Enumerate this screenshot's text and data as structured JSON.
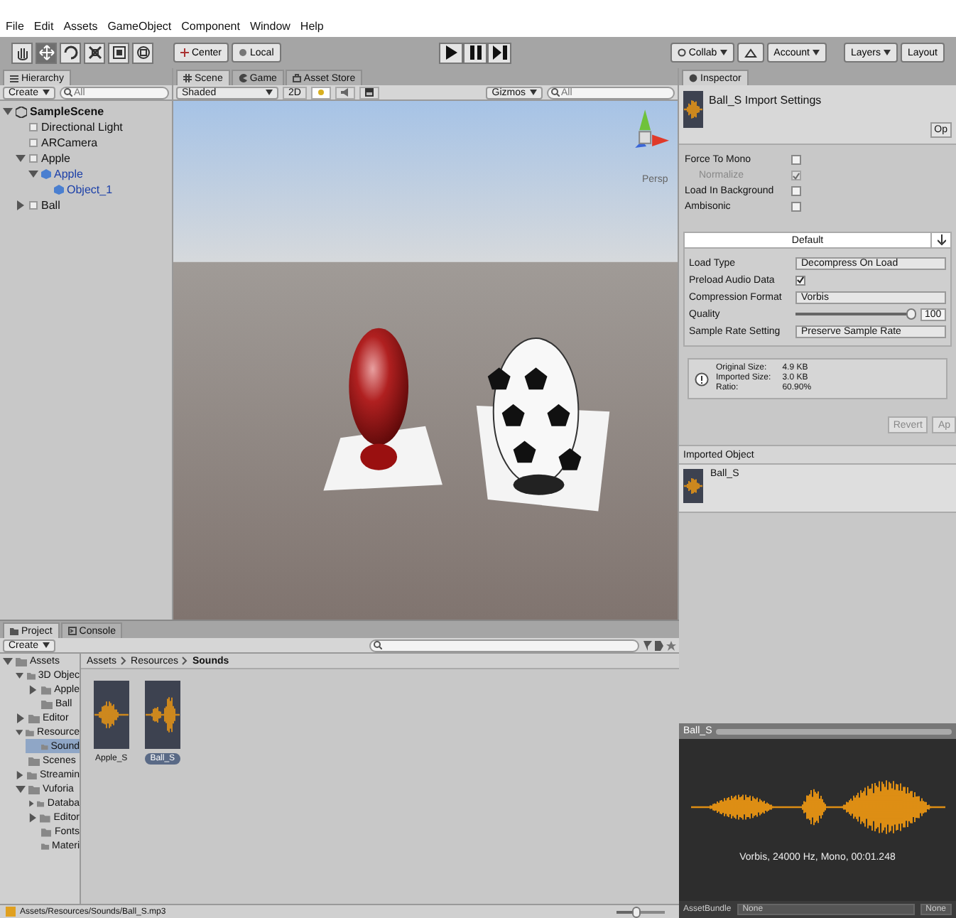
{
  "menu": [
    "File",
    "Edit",
    "Assets",
    "GameObject",
    "Component",
    "Window",
    "Help"
  ],
  "toolbar": {
    "tools": [
      {
        "kind": "hand",
        "selected": false
      },
      {
        "kind": "move",
        "selected": true
      },
      {
        "kind": "rotate",
        "selected": false
      },
      {
        "kind": "scale",
        "selected": false
      },
      {
        "kind": "rect",
        "selected": false
      },
      {
        "kind": "transform",
        "selected": false
      }
    ],
    "pivot": [
      {
        "kind": "pivot",
        "label": "Center"
      },
      {
        "kind": "space",
        "label": "Local"
      }
    ],
    "playback": [
      {
        "kind": "play"
      },
      {
        "kind": "pause"
      },
      {
        "kind": "step"
      }
    ],
    "collab": "Collab",
    "account": "Account",
    "layers": "Layers",
    "layout": "Layout"
  },
  "hierarchy": {
    "tab": "Hierarchy",
    "create": "Create",
    "search_placeholder": "All",
    "tree": [
      {
        "name": "SampleScene",
        "kind": "scene",
        "expanded": true,
        "children": [
          {
            "name": "Directional Light",
            "kind": "object"
          },
          {
            "name": "ARCamera",
            "kind": "object"
          },
          {
            "name": "Apple",
            "kind": "object",
            "expanded": true,
            "children": [
              {
                "name": "Apple",
                "kind": "prefab",
                "expanded": true,
                "children": [
                  {
                    "name": "Object_1",
                    "kind": "prefab"
                  }
                ]
              }
            ]
          },
          {
            "name": "Ball",
            "kind": "object",
            "expanded": false
          }
        ]
      }
    ]
  },
  "scene": {
    "tabs": [
      {
        "label": "Scene",
        "kind": "scene",
        "selected": true
      },
      {
        "label": "Game",
        "kind": "game",
        "selected": false
      },
      {
        "label": "Asset Store",
        "kind": "store",
        "selected": false
      }
    ],
    "shading": "Shaded",
    "mode_2d": {
      "label": "2D",
      "on": false
    },
    "toggles": [
      {
        "kind": "light",
        "on": true
      },
      {
        "kind": "audio",
        "on": false
      },
      {
        "kind": "effects",
        "on": false
      }
    ],
    "gizmos": "Gizmos",
    "search_placeholder": "All",
    "view_label": "Persp"
  },
  "inspector": {
    "tab": "Inspector",
    "title": "Ball_S Import Settings",
    "open_button": "Op",
    "options": [
      {
        "label": "Force To Mono",
        "checked": false,
        "disabled": false,
        "children": [
          {
            "label": "Normalize",
            "checked": true,
            "disabled": true
          }
        ]
      },
      {
        "label": "Load In Background",
        "checked": false,
        "disabled": false
      },
      {
        "label": "Ambisonic",
        "checked": false,
        "disabled": false
      }
    ],
    "platform_tab": "Default",
    "settings": [
      {
        "kind": "dropdown",
        "label": "Load Type",
        "value": "Decompress On Load"
      },
      {
        "kind": "checkbox",
        "label": "Preload Audio Data",
        "checked": true
      },
      {
        "kind": "dropdown",
        "label": "Compression Format",
        "value": "Vorbis"
      },
      {
        "kind": "slider",
        "label": "Quality",
        "level": 1,
        "value": "100"
      },
      {
        "kind": "dropdown",
        "label": "Sample Rate Setting",
        "value": "Preserve Sample Rate"
      }
    ],
    "info": [
      {
        "label": "Original Size:",
        "value": "4.9 KB"
      },
      {
        "label": "Imported Size:",
        "value": "3.0 KB"
      },
      {
        "label": "Ratio:",
        "value": "60.90%"
      }
    ],
    "buttons": [
      "Revert",
      "Ap"
    ],
    "imported_object": {
      "header": "Imported Object",
      "name": "Ball_S"
    },
    "preview": {
      "title": "Ball_S",
      "caption": "Vorbis, 24000 Hz, Mono, 00:01.248"
    },
    "asset_bundle": {
      "label": "AssetBundle",
      "value": "None",
      "variant": "None"
    }
  },
  "project": {
    "tabs": [
      {
        "label": "Project",
        "kind": "project",
        "selected": true
      },
      {
        "label": "Console",
        "kind": "console",
        "selected": false
      }
    ],
    "create": "Create",
    "tree": [
      {
        "name": "Assets",
        "selected": false,
        "expanded": true,
        "children": [
          {
            "name": "3D Objec",
            "selected": false,
            "expanded": true,
            "children": [
              {
                "name": "Apple",
                "selected": false,
                "expanded": false
              },
              {
                "name": "Ball",
                "selected": false
              }
            ]
          },
          {
            "name": "Editor",
            "selected": false,
            "expanded": false
          },
          {
            "name": "Resource",
            "selected": false,
            "expanded": true,
            "children": [
              {
                "name": "Sound",
                "selected": true
              }
            ]
          },
          {
            "name": "Scenes",
            "selected": false
          },
          {
            "name": "Streamin",
            "selected": false,
            "expanded": false
          },
          {
            "name": "Vuforia",
            "selected": false,
            "expanded": true,
            "children": [
              {
                "name": "Databa",
                "selected": false,
                "expanded": false
              },
              {
                "name": "Editor",
                "selected": false,
                "expanded": false
              },
              {
                "name": "Fonts",
                "selected": false
              },
              {
                "name": "Materi",
                "selected": false
              }
            ]
          }
        ]
      }
    ],
    "breadcrumb": [
      "Assets",
      "Resources",
      "Sounds"
    ],
    "assets": [
      {
        "name": "Apple_S",
        "selected": false
      },
      {
        "name": "Ball_S",
        "selected": true
      }
    ],
    "path": "Assets/Resources/Sounds/Ball_S.mp3",
    "zoom": {
      "level": 0.4
    }
  }
}
